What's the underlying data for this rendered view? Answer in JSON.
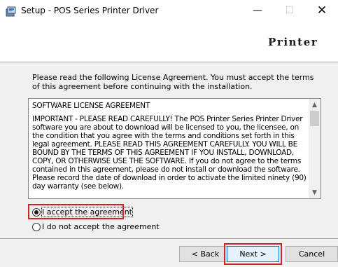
{
  "window": {
    "title": "Setup - POS Series Printer Driver",
    "minimize_symbol": "—",
    "maximize_symbol": "☐",
    "close_symbol": "✕",
    "icon": "installer-icon"
  },
  "header": {
    "brand": "Printer"
  },
  "intro": "Please read the following License Agreement. You must accept the terms of this agreement before continuing with the installation.",
  "license": {
    "title": "SOFTWARE LICENSE AGREEMENT",
    "body": "IMPORTANT - PLEASE READ CAREFULLY!  The POS Printer Series Printer Driver software you are about to download will be licensed to you, the licensee, on the condition that you agree with the terms and conditions set forth in this legal agreement.  PLEASE READ THIS AGREEMENT CAREFULLY.  YOU WILL BE BOUND BY THE TERMS OF THIS AGREEMENT IF YOU INSTALL, DOWNLOAD, COPY, OR OTHERWISE USE THE SOFTWARE. If you do not agree to the terms contained in this agreement, please do not install or download the software.  Please record the date of download in order to activate the limited ninety (90) day warranty (see below)."
  },
  "options": {
    "accept": "I accept the agreement",
    "decline": "I do not accept the agreement",
    "selected": "accept"
  },
  "buttons": {
    "back": "< Back",
    "next": "Next >",
    "cancel": "Cancel"
  },
  "colors": {
    "highlight": "#d1232a",
    "focus_border": "#0078d7"
  }
}
